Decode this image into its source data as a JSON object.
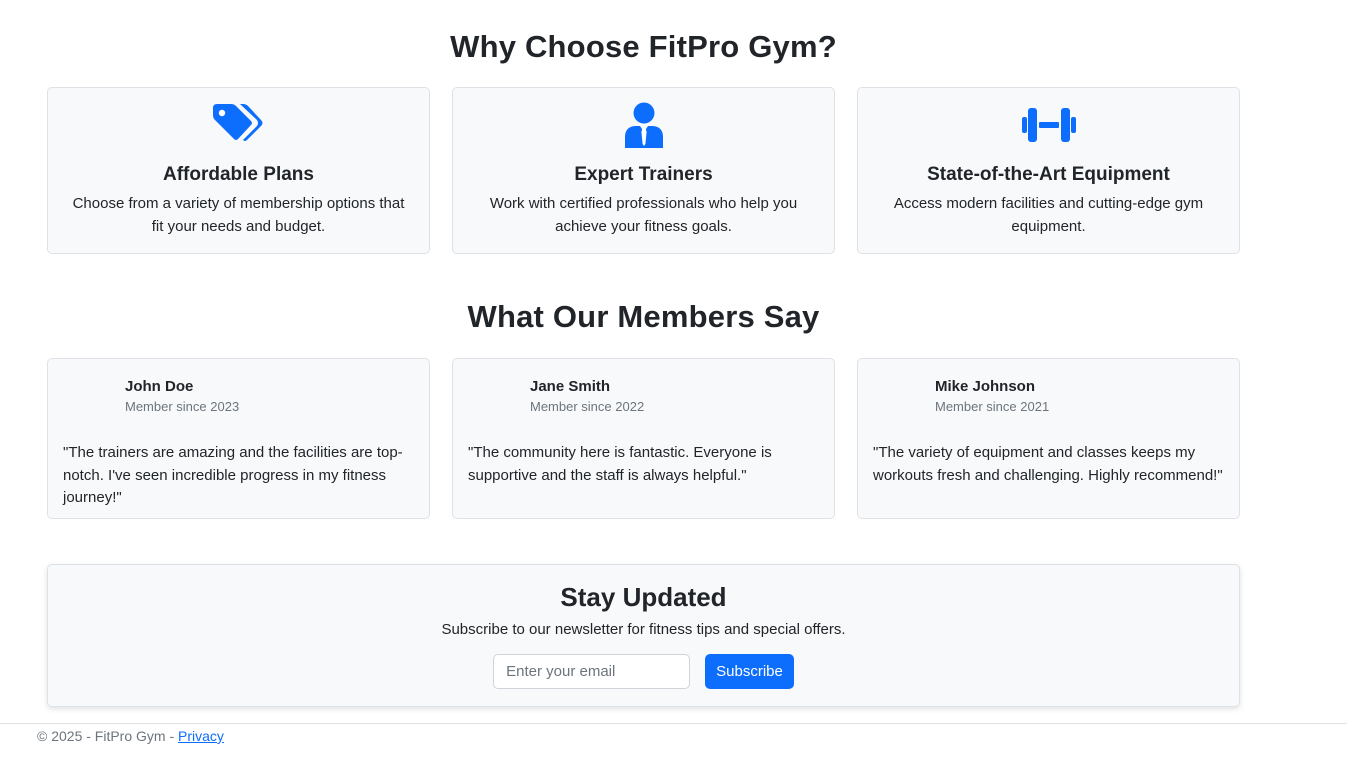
{
  "features_section": {
    "title": "Why Choose FitPro Gym?",
    "cards": [
      {
        "icon": "tags-icon",
        "title": "Affordable Plans",
        "text": "Choose from a variety of membership options that fit your needs and budget."
      },
      {
        "icon": "person-tie-icon",
        "title": "Expert Trainers",
        "text": "Work with certified professionals who help you achieve your fitness goals."
      },
      {
        "icon": "dumbbell-icon",
        "title": "State-of-the-Art Equipment",
        "text": "Access modern facilities and cutting-edge gym equipment."
      }
    ]
  },
  "testimonials_section": {
    "title": "What Our Members Say",
    "items": [
      {
        "name": "John Doe",
        "since": "Member since 2023",
        "quote": "\"The trainers are amazing and the facilities are top-notch. I've seen incredible progress in my fitness journey!\""
      },
      {
        "name": "Jane Smith",
        "since": "Member since 2022",
        "quote": "\"The community here is fantastic. Everyone is supportive and the staff is always helpful.\""
      },
      {
        "name": "Mike Johnson",
        "since": "Member since 2021",
        "quote": "\"The variety of equipment and classes keeps my workouts fresh and challenging. Highly recommend!\""
      }
    ]
  },
  "newsletter": {
    "title": "Stay Updated",
    "text": "Subscribe to our newsletter for fitness tips and special offers.",
    "email_placeholder": "Enter your email",
    "button_label": "Subscribe"
  },
  "footer": {
    "text": "© 2025 - FitPro Gym - ",
    "privacy_link": "Privacy"
  },
  "colors": {
    "accent": "#0d6efd",
    "card_bg": "#f8f9fa",
    "border": "#dee2e6",
    "text": "#212529",
    "muted": "#6c757d"
  }
}
